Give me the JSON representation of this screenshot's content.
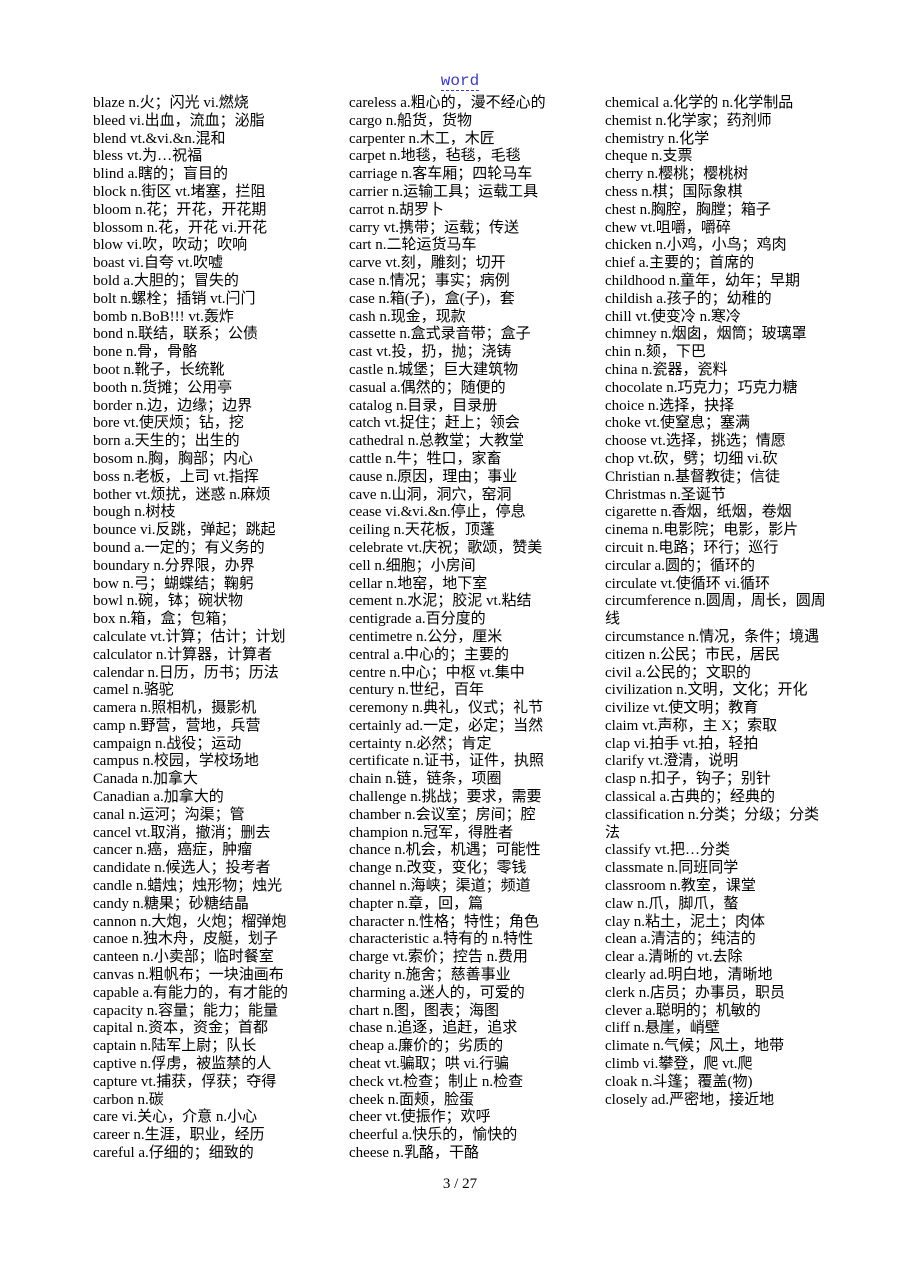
{
  "header": {
    "link_text": "word"
  },
  "columns": [
    [
      "blaze n.火；闪光  vi.燃烧",
      "bleed vi.出血，流血；泌脂",
      "blend vt.&vi.&n.混和",
      "bless vt.为…祝福",
      "blind a.瞎的；盲目的",
      "block n.街区  vt.堵塞，拦阻",
      "bloom n.花；开花，开花期",
      "blossom n.花，开花  vi.开花",
      "blow vi.吹，吹动；吹响",
      "boast vi.自夸  vt.吹嘘",
      "bold a.大胆的；冒失的",
      "bolt n.螺栓；插销  vt.闩门",
      "bomb n.BoB!!! vt.轰炸",
      "bond n.联结，联系；公债",
      "bone n.骨，骨骼",
      "boot n.靴子，长统靴",
      "booth n.货摊；公用亭",
      "border n.边，边缘；边界",
      "bore vt.使厌烦；钻，挖",
      "born a.天生的；出生的",
      "bosom n.胸，胸部；内心",
      "boss n.老板，上司  vt.指挥",
      "bother vt.烦扰，迷惑  n.麻烦",
      "bough n.树枝",
      "bounce vi.反跳，弹起；跳起",
      "bound a.一定的；有义务的",
      "boundary n.分界限，办界",
      "bow n.弓；蝴蝶结；鞠躬",
      "bowl n.碗，钵；碗状物",
      "box n.箱，盒；包箱；",
      "calculate vt.计算；估计；计划",
      "calculator n.计算器，计算者",
      "calendar n.日历，历书；历法",
      "camel n.骆驼",
      "camera n.照相机，摄影机",
      "camp n.野营，营地，兵营",
      "campaign n.战役；运动",
      "campus n.校园，学校场地",
      "Canada n.加拿大",
      "Canadian a.加拿大的",
      "canal n.运河；沟渠；管",
      "cancel vt.取消，撤消；删去",
      "cancer n.癌，癌症，肿瘤",
      "candidate n.候选人；投考者",
      "candle n.蜡烛；烛形物；烛光",
      "candy n.糖果；砂糖结晶",
      "cannon n.大炮，火炮；榴弹炮",
      "canoe n.独木舟，皮艇，划子",
      "canteen n.小卖部；临时餐室",
      "canvas n.粗帆布；一块油画布",
      "capable a.有能力的，有才能的",
      "capacity n.容量；能力；能量",
      "capital n.资本，资金；首都",
      "captain n.陆军上尉；队长",
      "captive n.俘虏，被监禁的人",
      "capture vt.捕获，俘获；夺得",
      "carbon n.碳",
      "care vi.关心，介意  n.小心",
      "career n.生涯，职业，经历",
      "careful a.仔细的；细致的"
    ],
    [
      "careless a.粗心的，漫不经心的",
      "cargo n.船货，货物",
      "carpenter n.木工，木匠",
      "carpet n.地毯，毡毯，毛毯",
      "carriage n.客车厢；四轮马车",
      "carrier n.运输工具；运载工具",
      "carrot n.胡罗卜",
      "carry vt.携带；运载；传送",
      "cart n.二轮运货马车",
      "carve vt.刻，雕刻；切开",
      "case n.情况；事实；病例",
      "case n.箱(子)，盒(子)，套",
      "cash n.现金，现款",
      "cassette n.盒式录音带；盒子",
      "cast vt.投，扔，抛；浇铸",
      "castle n.城堡；巨大建筑物",
      "casual a.偶然的；随便的",
      "catalog n.目录，目录册",
      "catch vt.捉住；赶上；领会",
      "cathedral n.总教堂；大教堂",
      "cattle n.牛；牲口，家畜",
      "cause n.原因，理由；事业",
      "cave n.山洞，洞穴，窑洞",
      "cease vi.&vi.&n.停止，停息",
      "ceiling n.天花板，顶蓬",
      "celebrate vt.庆祝；歌颂，赞美",
      "cell n.细胞；小房间",
      "cellar n.地窑，地下室",
      "cement n.水泥；胶泥  vt.粘结",
      "centigrade a.百分度的",
      "centimetre n.公分，厘米",
      "central a.中心的；主要的",
      "centre n.中心；中枢  vt.集中",
      "century n.世纪，百年",
      "ceremony n.典礼，仪式；礼节",
      "certainly ad.一定，必定；当然",
      "certainty n.必然；肯定",
      "certificate n.证书，证件，执照",
      "chain n.链，链条，项圈",
      "challenge n.挑战；要求，需要",
      "chamber n.会议室；房间；腔",
      "champion n.冠军，得胜者",
      "chance n.机会，机遇；可能性",
      "change n.改变，变化；零钱",
      "channel n.海峡；渠道；频道",
      "chapter n.章，回，篇",
      "character n.性格；特性；角色",
      "characteristic a.特有的  n.特性",
      "charge vt.索价；控告  n.费用",
      "charity n.施舍；慈善事业",
      "charming a.迷人的，可爱的",
      "chart n.图，图表；海图",
      "chase n.追逐，追赶，追求",
      "cheap a.廉价的；劣质的",
      "cheat vt.骗取；哄  vi.行骗",
      "check vt.检查；制止  n.检查",
      "cheek n.面颊，脸蛋",
      "cheer vt.使振作；欢呼",
      "cheerful a.快乐的，愉快的",
      "cheese n.乳酪，干酪"
    ],
    [
      "chemical a.化学的  n.化学制品",
      "chemist n.化学家；药剂师",
      "chemistry n.化学",
      "cheque n.支票",
      "cherry n.樱桃；樱桃树",
      "chess n.棋；国际象棋",
      "chest n.胸腔，胸膛；箱子",
      "chew vt.咀嚼，嚼碎",
      "chicken n.小鸡，小鸟；鸡肉",
      "chief a.主要的；首席的",
      "childhood n.童年，幼年；早期",
      "childish a.孩子的；幼稚的",
      "chill vt.使变冷  n.寒冷",
      "chimney n.烟囱，烟筒；玻璃罩",
      "chin n.颏，下巴",
      "china n.瓷器，瓷料",
      "chocolate n.巧克力；巧克力糖",
      "choice n.选择，抉择",
      "choke vt.使窒息；塞满",
      "choose vt.选择，挑选；情愿",
      "chop vt.砍，劈；切细 vi.砍",
      "Christian n.基督教徒；信徒",
      "Christmas n.圣诞节",
      "cigarette n.香烟，纸烟，卷烟",
      "cinema n.电影院；电影，影片",
      "circuit n.电路；环行；巡行",
      "circular a.圆的；循环的",
      "circulate vt.使循环  vi.循环",
      "circumference n.圆周，周长，圆周线",
      "circumstance n.情况，条件；境遇",
      "citizen n.公民；市民，居民",
      "civil a.公民的；文职的",
      "civilization n.文明，文化；开化",
      "civilize vt.使文明；教育",
      "claim vt.声称，主 X；索取",
      "clap vi.拍手  vt.拍，轻拍",
      "clarify vt.澄清，说明",
      "clasp n.扣子，钩子；别针",
      "classical a.古典的；经典的",
      "classification n.分类；分级；分类法",
      "classify vt.把…分类",
      "classmate n.同班同学",
      "classroom n.教室，课堂",
      "claw n.爪，脚爪，螯",
      "clay n.粘土，泥土；肉体",
      "clean a.清洁的；纯洁的",
      "clear a.清晰的  vt.去除",
      "clearly ad.明白地，清晰地",
      "clerk n.店员；办事员，职员",
      "clever a.聪明的；机敏的",
      "cliff n.悬崖，峭壁",
      "climate n.气候；风土，地带",
      "climb vi.攀登，爬  vt.爬",
      "cloak n.斗篷；覆盖(物)",
      "closely ad.严密地，接近地"
    ]
  ],
  "footer": {
    "page_number": "3",
    "page_total": "27",
    "page_label": "3  / 27"
  }
}
